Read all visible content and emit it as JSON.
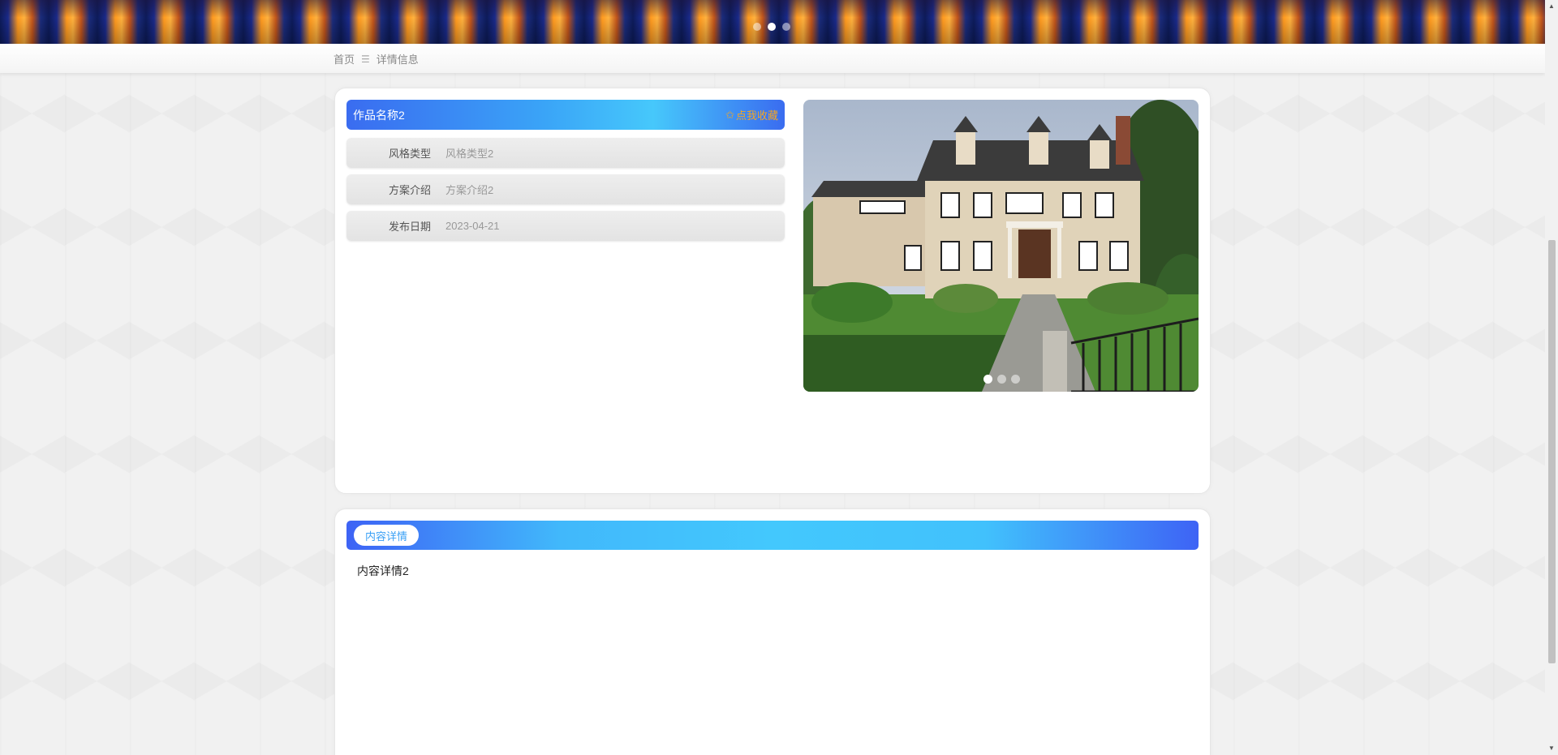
{
  "breadcrumb": {
    "home": "首页",
    "separator": "☰",
    "current": "详情信息"
  },
  "product": {
    "name": "作品名称2",
    "favorite_label": "点我收藏",
    "favorite_icon": "star-outline-icon",
    "fields": [
      {
        "label": "风格类型",
        "value": "风格类型2"
      },
      {
        "label": "方案介绍",
        "value": "方案介绍2"
      },
      {
        "label": "发布日期",
        "value": "2023-04-21"
      }
    ]
  },
  "carousel": {
    "banner_active_index": 1,
    "banner_count": 3,
    "photo_active_index": 0,
    "photo_count": 3
  },
  "details": {
    "section_title": "内容详情",
    "body": "内容详情2"
  },
  "colors": {
    "accent_blue": "#3a6cf0",
    "accent_cyan": "#43c8fd",
    "favorite_orange": "#f5a623"
  }
}
